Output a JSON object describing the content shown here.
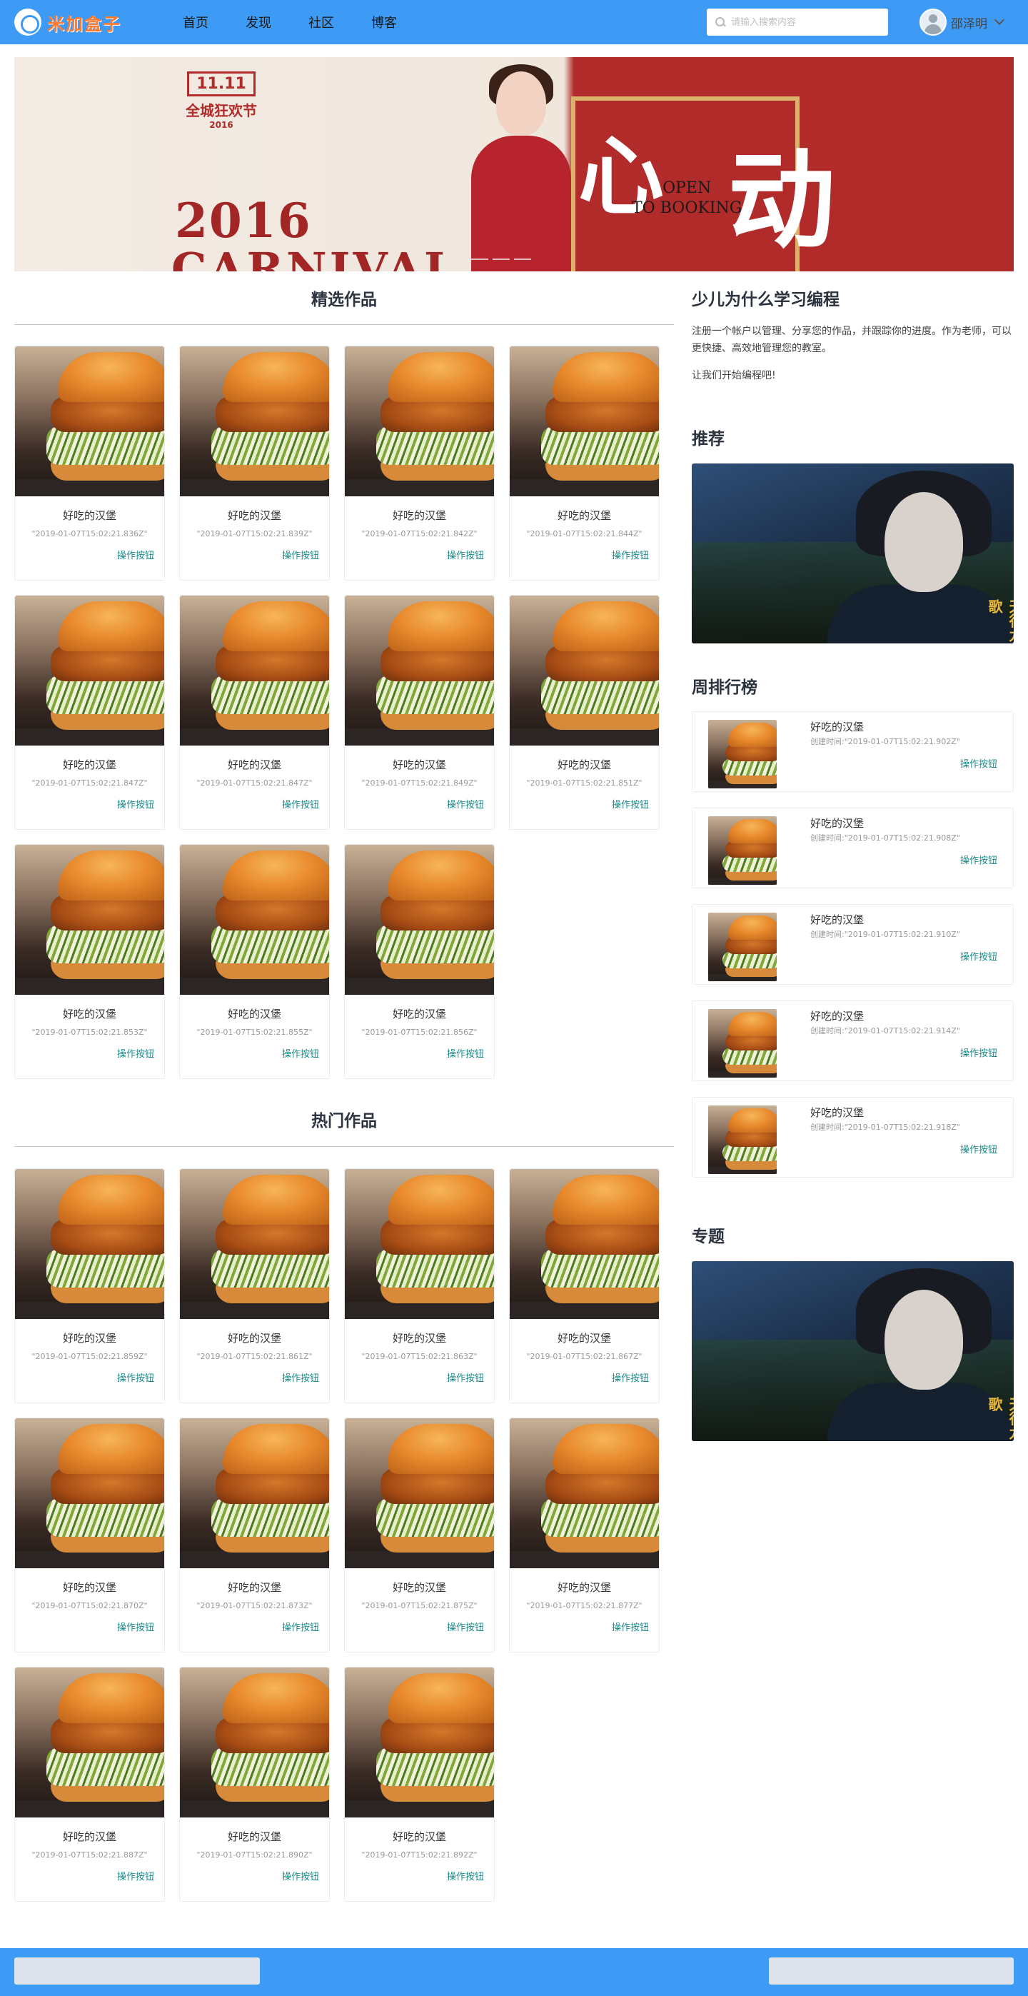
{
  "header": {
    "logo_text": "米加盒子",
    "nav": [
      "首页",
      "发现",
      "社区",
      "博客"
    ],
    "search_placeholder": "请输入搜索内容",
    "user_name": "邵泽明"
  },
  "banner": {
    "stamp_top": "11.11",
    "stamp_mid": "全城狂欢节",
    "stamp_year": "2016",
    "year": "2016",
    "carnival": "CARNIVAL",
    "heart": "心",
    "open_line1": "OPEN",
    "open_line2": "TO BOOKING",
    "move": "动"
  },
  "featured": {
    "title": "精选作品",
    "items": [
      {
        "title": "好吃的汉堡",
        "time": "\"2019-01-07T15:02:21.836Z\"",
        "action": "操作按钮"
      },
      {
        "title": "好吃的汉堡",
        "time": "\"2019-01-07T15:02:21.839Z\"",
        "action": "操作按钮"
      },
      {
        "title": "好吃的汉堡",
        "time": "\"2019-01-07T15:02:21.842Z\"",
        "action": "操作按钮"
      },
      {
        "title": "好吃的汉堡",
        "time": "\"2019-01-07T15:02:21.844Z\"",
        "action": "操作按钮"
      },
      {
        "title": "好吃的汉堡",
        "time": "\"2019-01-07T15:02:21.847Z\"",
        "action": "操作按钮"
      },
      {
        "title": "好吃的汉堡",
        "time": "\"2019-01-07T15:02:21.847Z\"",
        "action": "操作按钮"
      },
      {
        "title": "好吃的汉堡",
        "time": "\"2019-01-07T15:02:21.849Z\"",
        "action": "操作按钮"
      },
      {
        "title": "好吃的汉堡",
        "time": "\"2019-01-07T15:02:21.851Z\"",
        "action": "操作按钮"
      },
      {
        "title": "好吃的汉堡",
        "time": "\"2019-01-07T15:02:21.853Z\"",
        "action": "操作按钮"
      },
      {
        "title": "好吃的汉堡",
        "time": "\"2019-01-07T15:02:21.855Z\"",
        "action": "操作按钮"
      },
      {
        "title": "好吃的汉堡",
        "time": "\"2019-01-07T15:02:21.856Z\"",
        "action": "操作按钮"
      }
    ]
  },
  "hot": {
    "title": "热门作品",
    "items": [
      {
        "title": "好吃的汉堡",
        "time": "\"2019-01-07T15:02:21.859Z\"",
        "action": "操作按钮"
      },
      {
        "title": "好吃的汉堡",
        "time": "\"2019-01-07T15:02:21.861Z\"",
        "action": "操作按钮"
      },
      {
        "title": "好吃的汉堡",
        "time": "\"2019-01-07T15:02:21.863Z\"",
        "action": "操作按钮"
      },
      {
        "title": "好吃的汉堡",
        "time": "\"2019-01-07T15:02:21.867Z\"",
        "action": "操作按钮"
      },
      {
        "title": "好吃的汉堡",
        "time": "\"2019-01-07T15:02:21.870Z\"",
        "action": "操作按钮"
      },
      {
        "title": "好吃的汉堡",
        "time": "\"2019-01-07T15:02:21.873Z\"",
        "action": "操作按钮"
      },
      {
        "title": "好吃的汉堡",
        "time": "\"2019-01-07T15:02:21.875Z\"",
        "action": "操作按钮"
      },
      {
        "title": "好吃的汉堡",
        "time": "\"2019-01-07T15:02:21.877Z\"",
        "action": "操作按钮"
      },
      {
        "title": "好吃的汉堡",
        "time": "\"2019-01-07T15:02:21.887Z\"",
        "action": "操作按钮"
      },
      {
        "title": "好吃的汉堡",
        "time": "\"2019-01-07T15:02:21.890Z\"",
        "action": "操作按钮"
      },
      {
        "title": "好吃的汉堡",
        "time": "\"2019-01-07T15:02:21.892Z\"",
        "action": "操作按钮"
      }
    ]
  },
  "sidebar": {
    "why_title": "少儿为什么学习编程",
    "why_text": "注册一个帐户以管理、分享您的作品，并跟踪你的进度。作为老师，可以更快捷、高效地管理您的教室。",
    "why_cta": "让我们开始编程吧!",
    "recommend_title": "推荐",
    "poster_sig": "天行九歌",
    "ranking_title": "周排行榜",
    "ranking": [
      {
        "title": "好吃的汉堡",
        "time": "创建时间:\"2019-01-07T15:02:21.902Z\"",
        "action": "操作按钮"
      },
      {
        "title": "好吃的汉堡",
        "time": "创建时间:\"2019-01-07T15:02:21.908Z\"",
        "action": "操作按钮"
      },
      {
        "title": "好吃的汉堡",
        "time": "创建时间:\"2019-01-07T15:02:21.910Z\"",
        "action": "操作按钮"
      },
      {
        "title": "好吃的汉堡",
        "time": "创建时间:\"2019-01-07T15:02:21.914Z\"",
        "action": "操作按钮"
      },
      {
        "title": "好吃的汉堡",
        "time": "创建时间:\"2019-01-07T15:02:21.918Z\"",
        "action": "操作按钮"
      }
    ],
    "topic_title": "专题"
  },
  "colors": {
    "brand_blue": "#3d9bf5",
    "action_teal": "#1b8a8a",
    "banner_red": "#b22b2b"
  }
}
